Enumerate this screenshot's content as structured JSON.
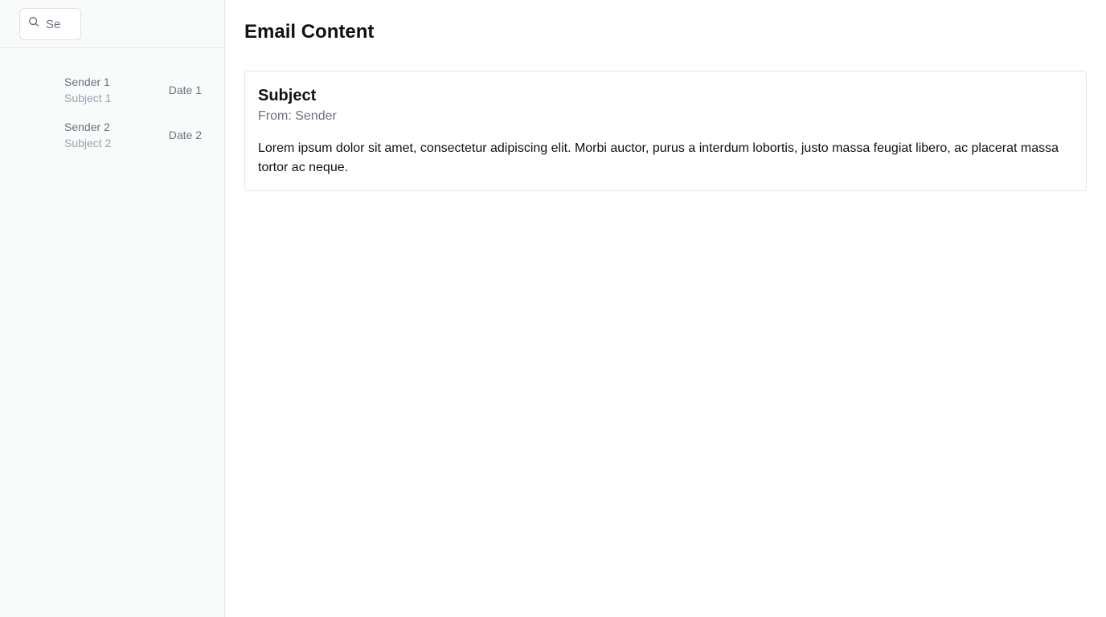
{
  "search": {
    "placeholder": "Se"
  },
  "emails": [
    {
      "sender": "Sender 1",
      "subject": "Subject 1",
      "date": "Date 1"
    },
    {
      "sender": "Sender 2",
      "subject": "Subject 2",
      "date": "Date 2"
    }
  ],
  "main": {
    "title": "Email Content",
    "email": {
      "subject": "Subject",
      "from": "From: Sender",
      "body": "Lorem ipsum dolor sit amet, consectetur adipiscing elit. Morbi auctor, purus a interdum lobortis, justo massa feugiat libero, ac placerat massa tortor ac neque."
    }
  },
  "icons": {
    "search": "search-icon"
  }
}
